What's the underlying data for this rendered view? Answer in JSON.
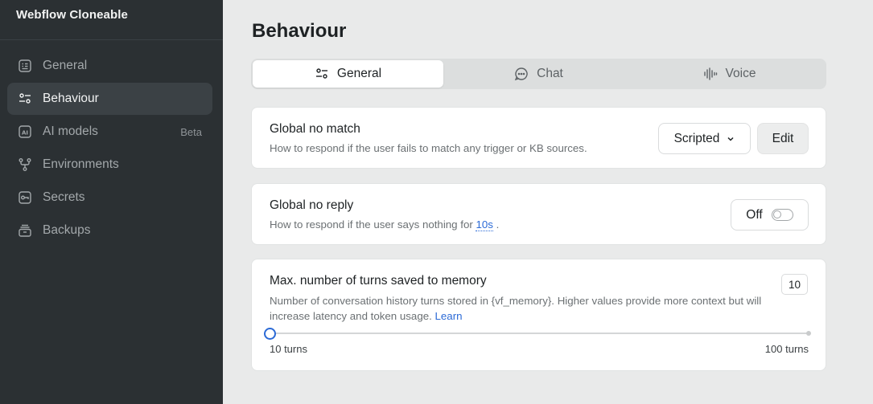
{
  "workspace": {
    "title": "Webflow Cloneable"
  },
  "sidebar": {
    "items": [
      {
        "label": "General",
        "icon": "document-list-icon",
        "badge": ""
      },
      {
        "label": "Behaviour",
        "icon": "sliders-icon",
        "badge": ""
      },
      {
        "label": "AI models",
        "icon": "ai-icon",
        "badge": "Beta"
      },
      {
        "label": "Environments",
        "icon": "branch-icon",
        "badge": ""
      },
      {
        "label": "Secrets",
        "icon": "key-icon",
        "badge": ""
      },
      {
        "label": "Backups",
        "icon": "stack-icon",
        "badge": ""
      }
    ],
    "active_index": 1
  },
  "page": {
    "title": "Behaviour"
  },
  "tabs": [
    {
      "label": "General",
      "icon": "sliders-icon"
    },
    {
      "label": "Chat",
      "icon": "chat-icon"
    },
    {
      "label": "Voice",
      "icon": "waveform-icon"
    }
  ],
  "no_match": {
    "title": "Global no match",
    "description": "How to respond if the user fails to match any trigger or KB sources.",
    "select_value": "Scripted",
    "edit_label": "Edit"
  },
  "no_reply": {
    "title": "Global no reply",
    "desc_prefix": "How to respond if the user says nothing for",
    "timeout": "10s",
    "desc_suffix": ".",
    "toggle_label": "Off",
    "toggle_on": false
  },
  "memory": {
    "title": "Max. number of turns saved to memory",
    "value": "10",
    "description": "Number of conversation history turns stored in {vf_memory}. Higher values provide more context but will increase latency and token usage.",
    "learn_label": "Learn",
    "min_label": "10 turns",
    "max_label": "100 turns",
    "slider_value": 10,
    "slider_min": 10,
    "slider_max": 100
  },
  "colors": {
    "accent": "#2b6ad6",
    "sidebar_bg": "#2b3033",
    "page_bg": "#e9eaea"
  }
}
